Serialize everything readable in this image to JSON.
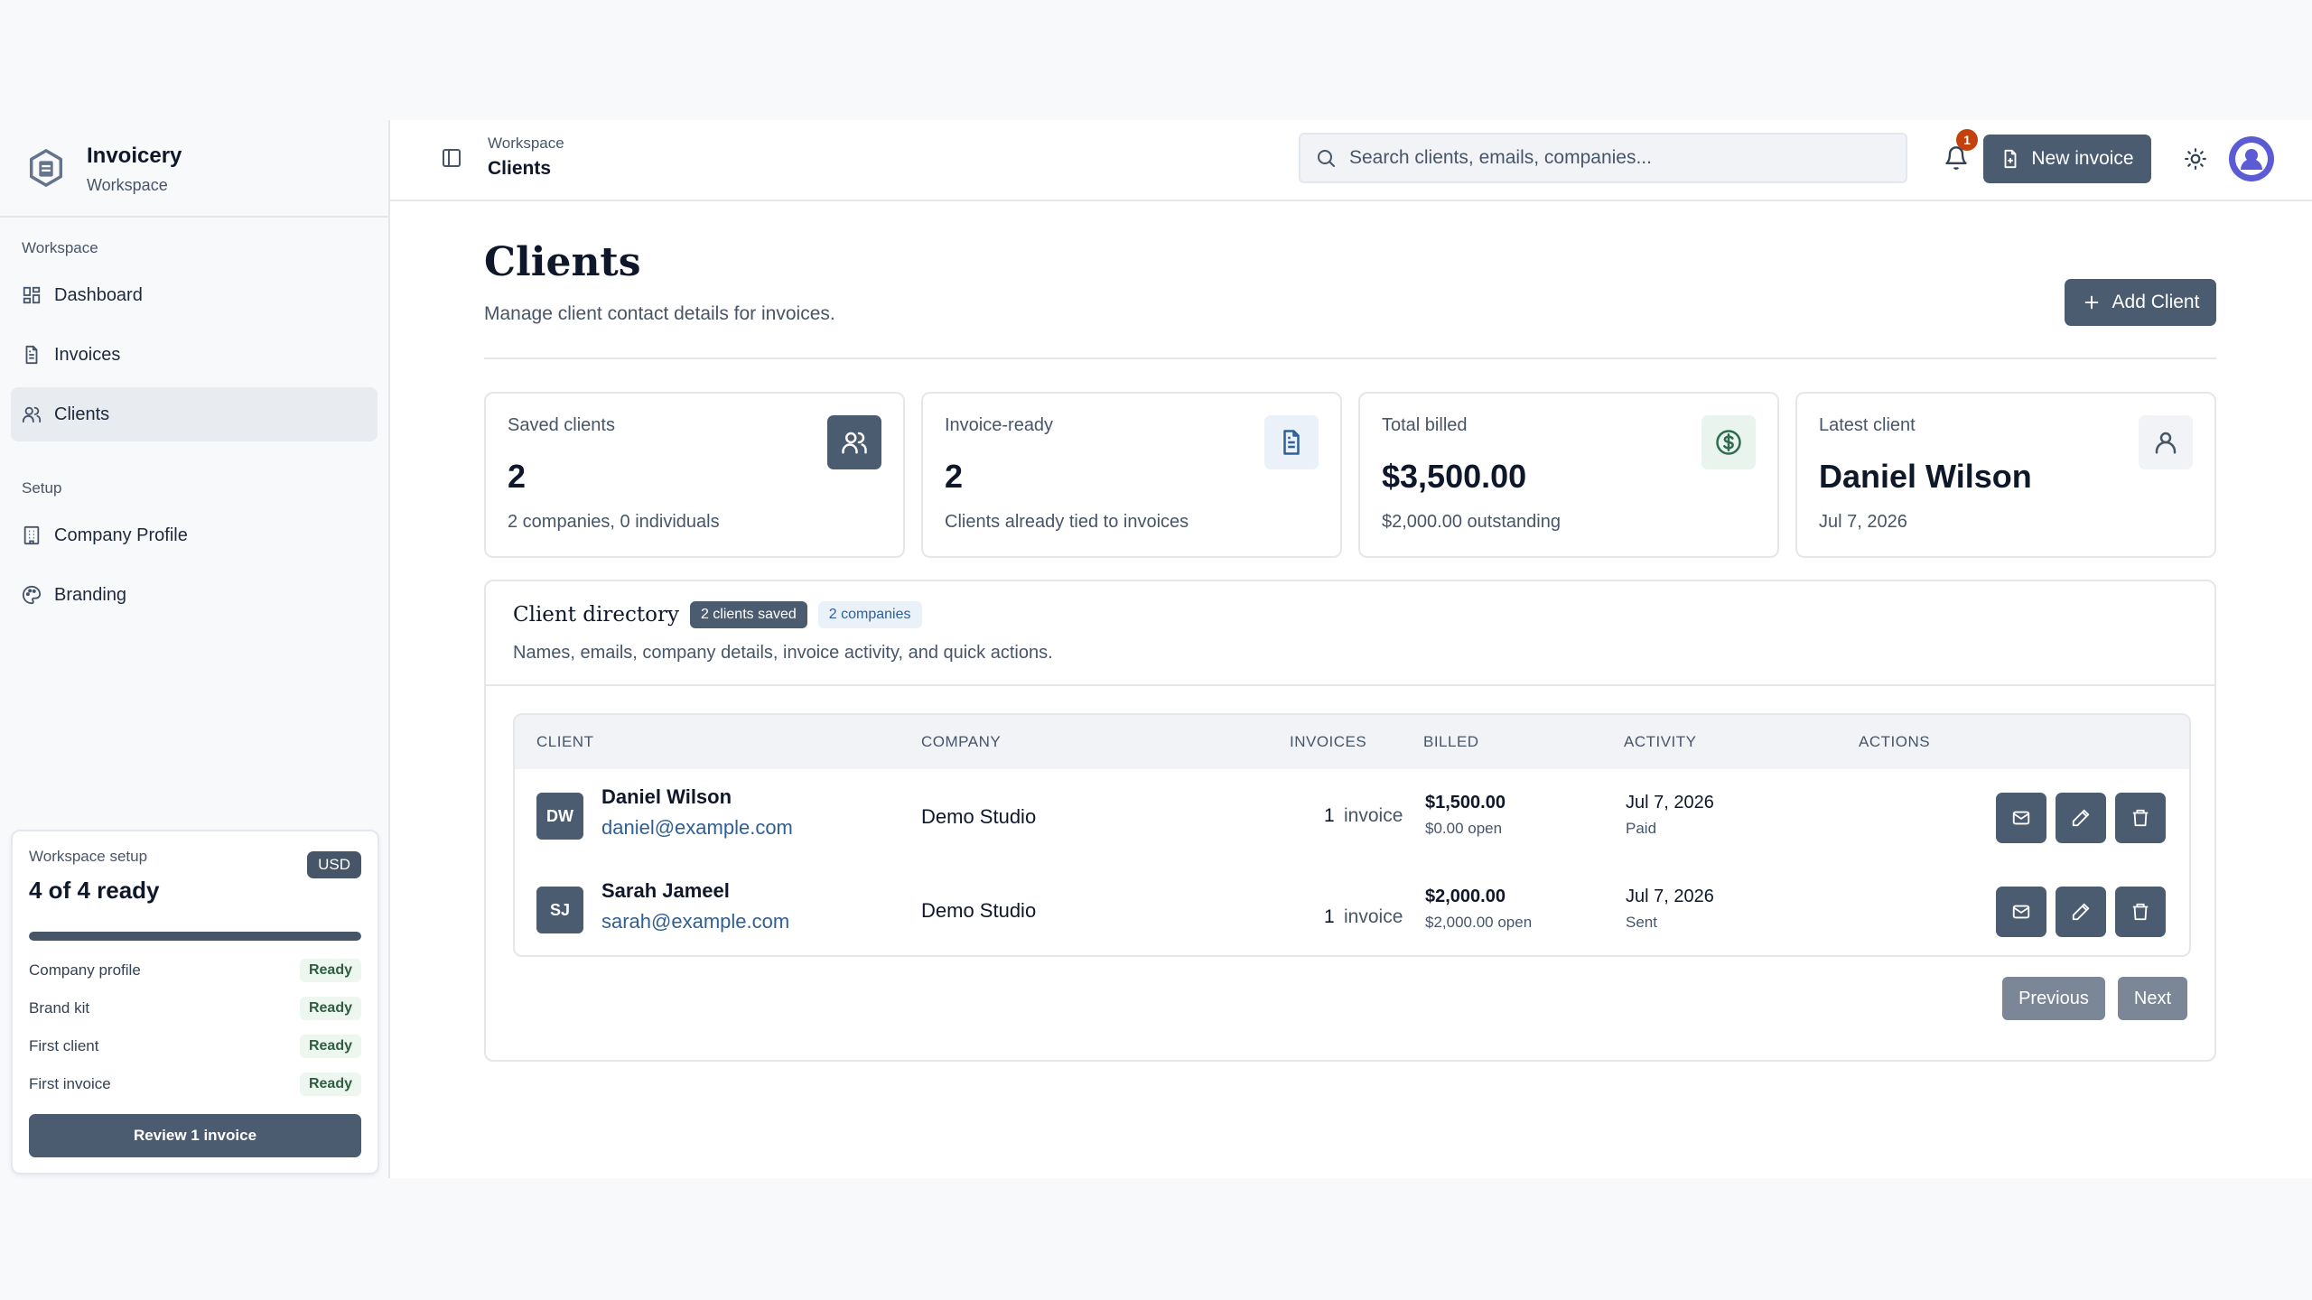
{
  "brand": {
    "name": "Invoicery",
    "subtitle": "Workspace"
  },
  "sidebar": {
    "sections": [
      {
        "label": "Workspace",
        "items": [
          {
            "label": "Dashboard",
            "icon": "dashboard-icon"
          },
          {
            "label": "Invoices",
            "icon": "file-text-icon"
          },
          {
            "label": "Clients",
            "icon": "users-icon",
            "active": true
          }
        ]
      },
      {
        "label": "Setup",
        "items": [
          {
            "label": "Company Profile",
            "icon": "building-icon"
          },
          {
            "label": "Branding",
            "icon": "palette-icon"
          }
        ]
      }
    ],
    "setup_card": {
      "label": "Workspace setup",
      "status": "4 of 4 ready",
      "currency": "USD",
      "progress_percent": 100,
      "checks": [
        {
          "label": "Company profile",
          "status": "Ready"
        },
        {
          "label": "Brand kit",
          "status": "Ready"
        },
        {
          "label": "First client",
          "status": "Ready"
        },
        {
          "label": "First invoice",
          "status": "Ready"
        }
      ],
      "cta": "Review 1 invoice"
    }
  },
  "topbar": {
    "breadcrumb_parent": "Workspace",
    "breadcrumb_current": "Clients",
    "search_placeholder": "Search clients, emails, companies...",
    "notification_count": "1",
    "new_invoice_label": "New invoice"
  },
  "page": {
    "title": "Clients",
    "subtitle": "Manage client contact details for invoices.",
    "add_button": "Add Client"
  },
  "stats": [
    {
      "label": "Saved clients",
      "value": "2",
      "note": "2 companies, 0 individuals",
      "icon": "users-icon",
      "icon_style": "dark"
    },
    {
      "label": "Invoice-ready",
      "value": "2",
      "note": "Clients already tied to invoices",
      "icon": "file-text-icon",
      "icon_style": "blue"
    },
    {
      "label": "Total billed",
      "value": "$3,500.00",
      "note": "$2,000.00 outstanding",
      "icon": "dollar-circle-icon",
      "icon_style": "green"
    },
    {
      "label": "Latest client",
      "value": "Daniel Wilson",
      "note": "Jul 7, 2026",
      "icon": "user-icon",
      "icon_style": "gray"
    }
  ],
  "directory": {
    "title": "Client directory",
    "badge_saved": "2 clients saved",
    "badge_companies": "2 companies",
    "subtitle": "Names, emails, company details, invoice activity, and quick actions.",
    "columns": [
      "Client",
      "Company",
      "Invoices",
      "Billed",
      "Activity",
      "Actions"
    ],
    "rows": [
      {
        "initials": "DW",
        "name": "Daniel Wilson",
        "email": "daniel@example.com",
        "company": "Demo Studio",
        "invoice_count": "1",
        "invoice_word": "invoice",
        "billed": "$1,500.00",
        "open": "$0.00 open",
        "date": "Jul 7, 2026",
        "status": "Paid"
      },
      {
        "initials": "SJ",
        "name": "Sarah Jameel",
        "email": "sarah@example.com",
        "company": "Demo Studio",
        "invoice_count": "1",
        "invoice_word": "invoice",
        "billed": "$2,000.00",
        "open": "$2,000.00 open",
        "date": "Jul 7, 2026",
        "status": "Sent"
      }
    ],
    "pager": {
      "previous": "Previous",
      "next": "Next"
    }
  },
  "colors": {
    "primary": "#4b5b70",
    "accent_blue": "#2f5f95",
    "notification": "#c2410c",
    "avatar": "#5b5bd6"
  }
}
